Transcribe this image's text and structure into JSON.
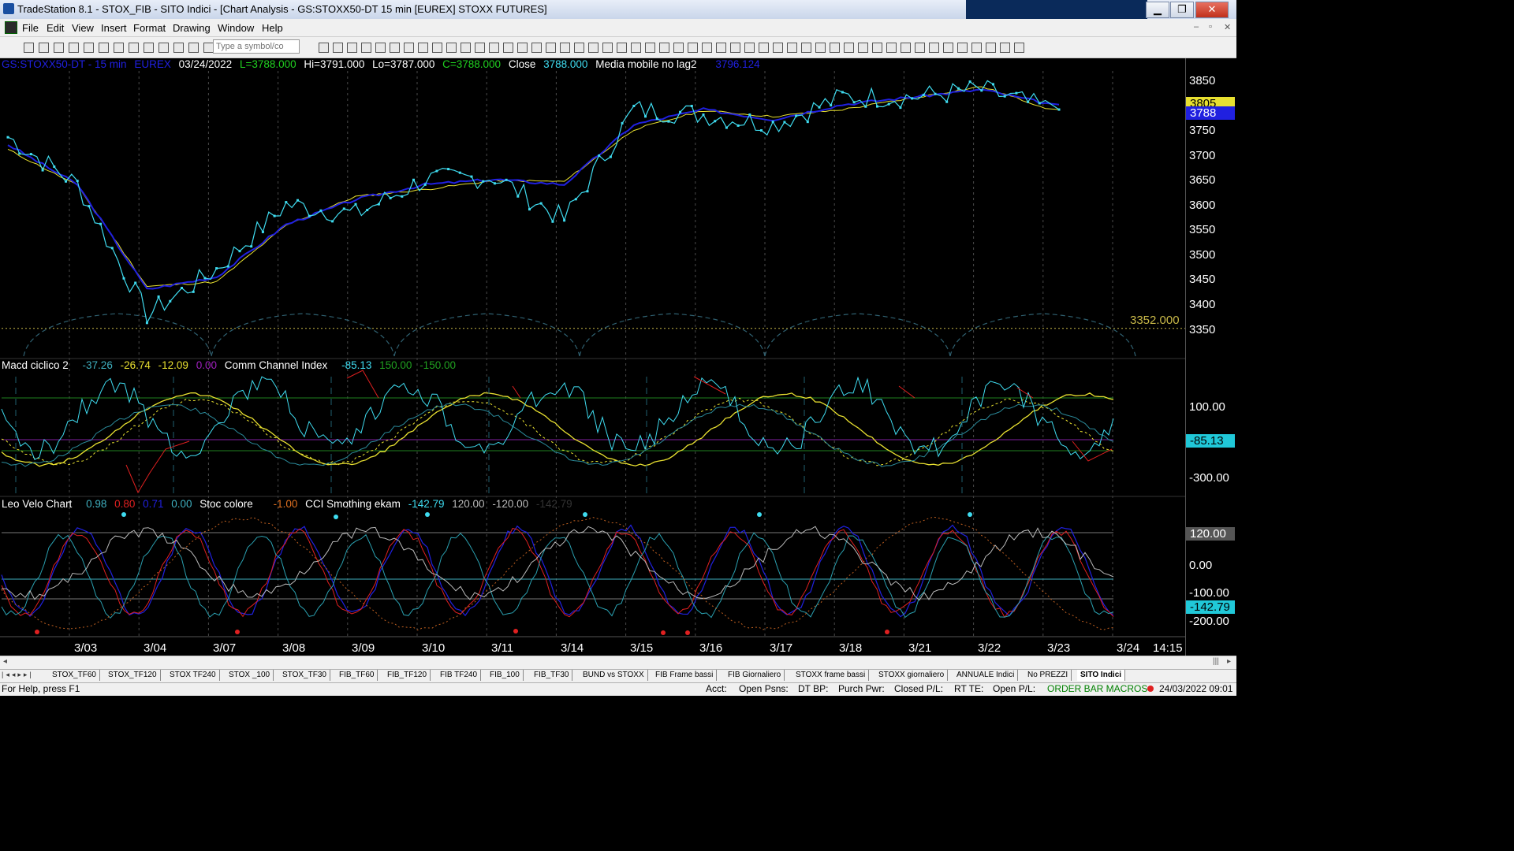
{
  "window": {
    "title": "TradeStation 8.1 - STOX_FIB - SITO Indici - [Chart Analysis - GS:STOXX50-DT  15 min  [EUREX] STOXX FUTURES]",
    "min": "▁",
    "max": "❐",
    "close": "✕"
  },
  "menu": [
    "File",
    "Edit",
    "View",
    "Insert",
    "Format",
    "Drawing",
    "Window",
    "Help"
  ],
  "mdi_buttons": [
    "–",
    "▫",
    "✕"
  ],
  "toolbar": {
    "symbol_placeholder": "Type a symbol/co"
  },
  "header": {
    "symbol": "GS:STOXX50-DT - 15 min",
    "exchange": "EUREX",
    "date": "03/24/2022",
    "last": "L=3788.000",
    "high": "Hi=3791.000",
    "low": "Lo=3787.000",
    "close_eq": "C=3788.000",
    "close_label": "Close",
    "close_value": "3788.000",
    "ma_label": "Media mobile no lag2",
    "ma_value": "3796.124"
  },
  "macd_header": {
    "name": "Macd ciclico 2",
    "v1": "-37.26",
    "v2": "-26.74",
    "v3": "-12.09",
    "v4": "0.00",
    "cci_name": "Comm Channel Index",
    "cci_value": "-85.13",
    "cci_hi": "150.00",
    "cci_lo": "-150.00"
  },
  "velo_header": {
    "name": "Leo Velo Chart",
    "v1": "0.98",
    "v2": "0.80",
    "v3": "0.71",
    "v4": "0.00",
    "stoc_name": "Stoc colore",
    "stoc_value": "-1.00",
    "cci_name": "CCI Smothing ekam",
    "cci_value": "-142.79",
    "cci_hi": "120.00",
    "cci_lo": "-120.00",
    "cci_ghost": "-142.79"
  },
  "price_axis": {
    "ticks": [
      "3850",
      "3800",
      "3750",
      "3700",
      "3650",
      "3600",
      "3550",
      "3500",
      "3450",
      "3400",
      "3350"
    ],
    "boxes": {
      "yellow": "3805",
      "blue": "3788"
    },
    "cycle_level": "3352.000"
  },
  "macd_axis": {
    "ticks": [
      "100.00",
      "-300.00"
    ],
    "box": "-85.13"
  },
  "velo_axis": {
    "ticks": [
      "120.00",
      "0.00",
      "-100.00",
      "-200.00"
    ],
    "box": "-142.79"
  },
  "x_axis": [
    "3/03",
    "3/04",
    "3/07",
    "3/08",
    "3/09",
    "3/10",
    "3/11",
    "3/14",
    "3/15",
    "3/16",
    "3/17",
    "3/18",
    "3/21",
    "3/22",
    "3/23",
    "3/24",
    "14:15"
  ],
  "tabs": [
    "STOX_TF60",
    "STOX_TF120",
    "STOX TF240",
    "STOX _100",
    "STOX_TF30",
    "FIB_TF60",
    "FIB_TF120",
    "FIB TF240",
    "FIB_100",
    "FIB_TF30",
    "BUND vs STOXX",
    "FIB Frame bassi",
    "FIB Giornaliero",
    "STOXX frame bassi",
    "STOXX giornaliero",
    "ANNUALE Indici",
    "No PREZZI",
    "SITO Indici"
  ],
  "status": {
    "help": "For Help, press F1",
    "acct": "Acct:",
    "open_psns": "Open Psns:",
    "dt_bp": "DT BP:",
    "purch_pwr": "Purch Pwr:",
    "closed_pl": "Closed P/L:",
    "rt_te": "RT TE:",
    "open_pl": "Open P/L:",
    "macros": "ORDER BAR  MACROS",
    "datetime": "24/03/2022 09:01"
  },
  "chart_data": {
    "type": "line",
    "title": "GS:STOXX50-DT - 15 min",
    "x": [
      "3/03",
      "3/04",
      "3/07",
      "3/08",
      "3/09",
      "3/10",
      "3/11",
      "3/14",
      "3/15",
      "3/16",
      "3/17",
      "3/18",
      "3/21",
      "3/22",
      "3/23",
      "3/24"
    ],
    "ylim": [
      3310,
      3870
    ],
    "series": [
      {
        "name": "Close",
        "color": "#3fdcf0",
        "values": [
          3735,
          3640,
          3380,
          3470,
          3600,
          3580,
          3650,
          3655,
          3570,
          3790,
          3780,
          3760,
          3815,
          3815,
          3830,
          3790
        ]
      },
      {
        "name": "Media mobile no lag2",
        "color": "#2020e0",
        "values": [
          3720,
          3640,
          3430,
          3455,
          3560,
          3610,
          3640,
          3650,
          3640,
          3760,
          3790,
          3770,
          3800,
          3815,
          3830,
          3800
        ]
      }
    ],
    "cycle_level": 3352
  },
  "colors": {
    "cyan": "#3fdcf0",
    "blue": "#2020e0",
    "yellow": "#e8e030",
    "green": "#20d020",
    "red": "#e02020",
    "olive": "#c8b848"
  }
}
